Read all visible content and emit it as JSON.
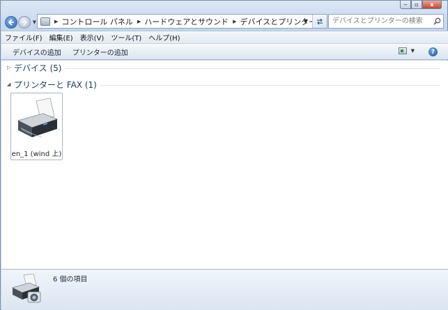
{
  "window": {
    "caption": {
      "min": "‒",
      "max": "▫",
      "close": "x"
    }
  },
  "nav": {
    "back_icon": "back-arrow-icon",
    "forward_icon": "forward-arrow-icon"
  },
  "address": {
    "crumbs": [
      "コントロール パネル",
      "ハードウェアとサウンド",
      "デバイスとプリンター"
    ]
  },
  "search": {
    "placeholder": "デバイスとプリンターの検索"
  },
  "menu": {
    "items": [
      "ファイル(F)",
      "編集(E)",
      "表示(V)",
      "ツール(T)",
      "ヘルプ(H)"
    ]
  },
  "toolbar": {
    "add_device": "デバイスの追加",
    "add_printer": "プリンターの追加",
    "help": "?"
  },
  "groups": [
    {
      "title": "デバイス (5)",
      "expanded": false
    },
    {
      "title": "プリンターと FAX (1)",
      "expanded": true
    }
  ],
  "devices": [
    {
      "label": "en_1 (wind 上)"
    }
  ],
  "details": {
    "count_text": "6 個の項目"
  },
  "colors": {
    "accent": "#2a62ad",
    "group_title": "#1e3a5f",
    "close_button": "#c8452f"
  }
}
